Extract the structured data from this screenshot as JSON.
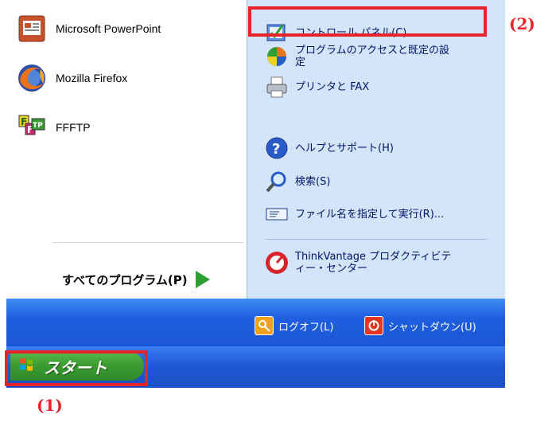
{
  "left_programs": [
    {
      "label": "Microsoft PowerPoint",
      "icon": "powerpoint-icon"
    },
    {
      "label": "Mozilla Firefox",
      "icon": "firefox-icon"
    },
    {
      "label": "FFFTP",
      "icon": "ffftp-icon"
    }
  ],
  "all_programs_label": "すべてのプログラム(P)",
  "right_items": [
    {
      "label": "コントロール パネル(C)",
      "icon": "control-panel-icon"
    },
    {
      "label": "プログラムのアクセスと既定の設\n定",
      "icon": "program-access-icon"
    },
    {
      "label": "プリンタと FAX",
      "icon": "printer-fax-icon"
    },
    {
      "label": "ヘルプとサポート(H)",
      "icon": "help-icon"
    },
    {
      "label": "検索(S)",
      "icon": "search-icon"
    },
    {
      "label": "ファイル名を指定して実行(R)...",
      "icon": "run-icon"
    },
    {
      "label": "ThinkVantage プロダクティビテ\nィー・センター",
      "icon": "thinkvantage-icon"
    }
  ],
  "bottom_bar": {
    "logoff_label": "ログオフ(L)",
    "shutdown_label": "シャットダウン(U)"
  },
  "start_label": "スタート",
  "annotations": {
    "label1": "(1)",
    "label2": "(2)"
  },
  "colors": {
    "annotation": "#e8232c",
    "right_pane": "#d3e5fa",
    "start_green": "#3a9a31",
    "bar_blue": "#1f5ee0"
  }
}
